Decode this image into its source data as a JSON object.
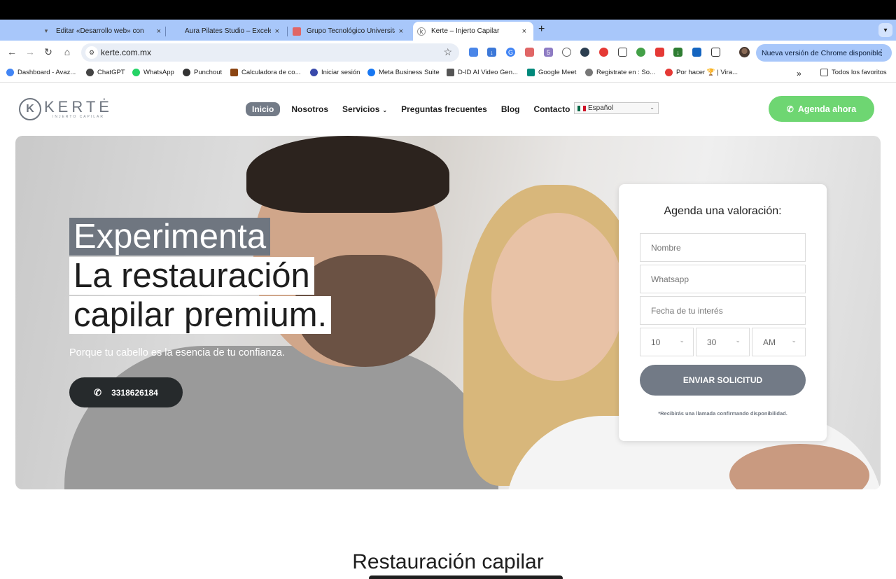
{
  "browser": {
    "tabs": [
      {
        "title": "Editar «Desarrollo web» con",
        "active": false
      },
      {
        "title": "Aura Pilates Studio – Excelen",
        "active": false
      },
      {
        "title": "Grupo Tecnológico Universita",
        "active": false
      },
      {
        "title": "Kerte – Injerto Capilar",
        "active": true
      }
    ],
    "new_tab": "+",
    "close": "×",
    "url": "kerte.com.mx",
    "update_label": "Nueva versión de Chrome disponible",
    "bookmarks": [
      "Dashboard - Avaz...",
      "ChatGPT",
      "WhatsApp",
      "Punchout",
      "Calculadora de co...",
      "Iniciar sesión",
      "Meta Business Suite",
      "D-ID AI Video Gen...",
      "Google Meet",
      "Registrate en : So...",
      "Por hacer 🏆 | Vira..."
    ],
    "all_bookmarks": "Todos los favoritos",
    "overflow": "»",
    "extension_badge": "5"
  },
  "site": {
    "logo": {
      "mark": "K",
      "name": "KERTĖ",
      "tagline": "INJERTO CAPILAR"
    },
    "nav": [
      {
        "label": "Inicio",
        "active": true,
        "dropdown": false
      },
      {
        "label": "Nosotros",
        "active": false,
        "dropdown": false
      },
      {
        "label": "Servicios",
        "active": false,
        "dropdown": true
      },
      {
        "label": "Preguntas frecuentes",
        "active": false,
        "dropdown": false
      },
      {
        "label": "Blog",
        "active": false,
        "dropdown": false
      },
      {
        "label": "Contacto",
        "active": false,
        "dropdown": true
      }
    ],
    "language": "Español",
    "cta": "Agenda ahora",
    "hero": {
      "lines": [
        "Experimenta",
        "La restauración",
        "capilar premium."
      ],
      "subtitle": "Porque tu cabello es la esencia de tu confianza.",
      "phone": "3318626184"
    },
    "form": {
      "title": "Agenda una valoración:",
      "name_placeholder": "Nombre",
      "whatsapp_placeholder": "Whatsapp",
      "date_placeholder": "Fecha de tu interés",
      "hour": "10",
      "minute": "30",
      "ampm": "AM",
      "submit": "ENVIAR SOLICITUD",
      "note": "*Recibirás una llamada confirmando disponibilidad."
    },
    "section_title": "Restauración capilar"
  },
  "colors": {
    "accent_green": "#6ed672",
    "brand_gray": "#6f7680",
    "tab_bar": "#a8c7fa"
  }
}
